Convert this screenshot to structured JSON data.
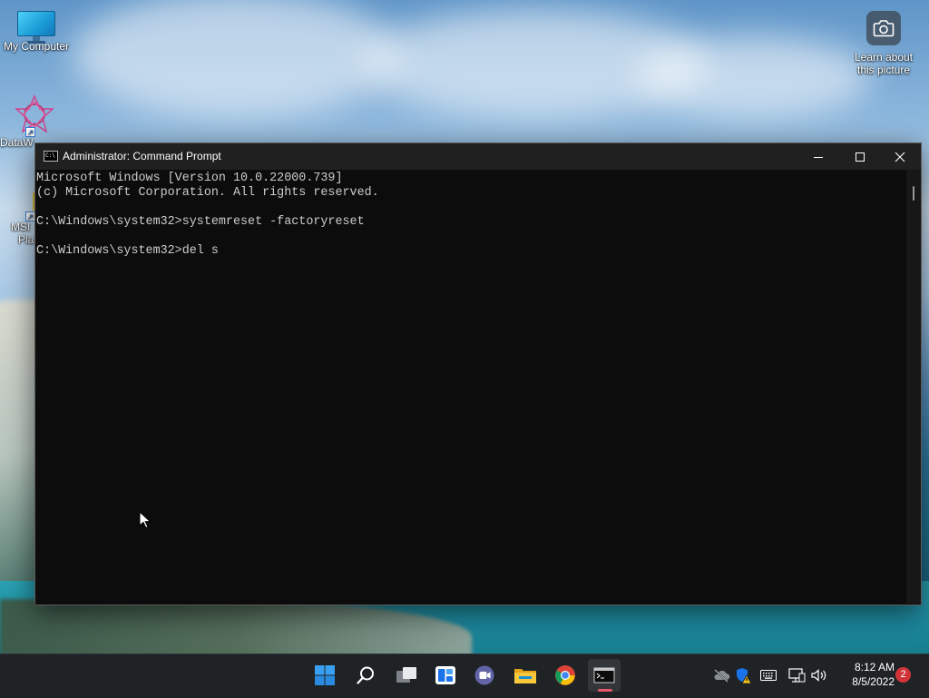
{
  "desktop": {
    "icons": [
      {
        "label": "My Computer",
        "icon": "monitor-icon"
      },
      {
        "label": "DataW",
        "icon": "datawave-icon"
      },
      {
        "label": "MSI",
        "label2": "Pla",
        "icon": "msi-app-icon"
      }
    ],
    "spotlight": {
      "label_line1": "Learn about",
      "label_line2": "this picture",
      "icon": "camera-icon"
    }
  },
  "window": {
    "title": "Administrator: Command Prompt",
    "icon": "cmd-icon",
    "console_lines": [
      "Microsoft Windows [Version 10.0.22000.739]",
      "(c) Microsoft Corporation. All rights reserved.",
      "",
      "C:\\Windows\\system32>systemreset -factoryreset",
      "",
      "C:\\Windows\\system32>del s"
    ]
  },
  "taskbar": {
    "apps": [
      "start-icon",
      "search-icon",
      "task-view-icon",
      "widgets-icon",
      "teams-chat-icon",
      "file-explorer-icon",
      "chrome-icon",
      "terminal-icon"
    ],
    "tray": [
      "onedrive-icon",
      "defender-warning-icon",
      "keyboard-icon",
      "network-icon",
      "volume-icon"
    ],
    "time": "8:12 AM",
    "date": "8/5/2022",
    "notification_count": "2"
  },
  "colors": {
    "console_bg": "#0c0c0c",
    "console_text": "#cccccc",
    "titlebar": "#202020",
    "taskbar": "#1f2326",
    "accent": "#0078d4",
    "badge": "#d13438"
  }
}
